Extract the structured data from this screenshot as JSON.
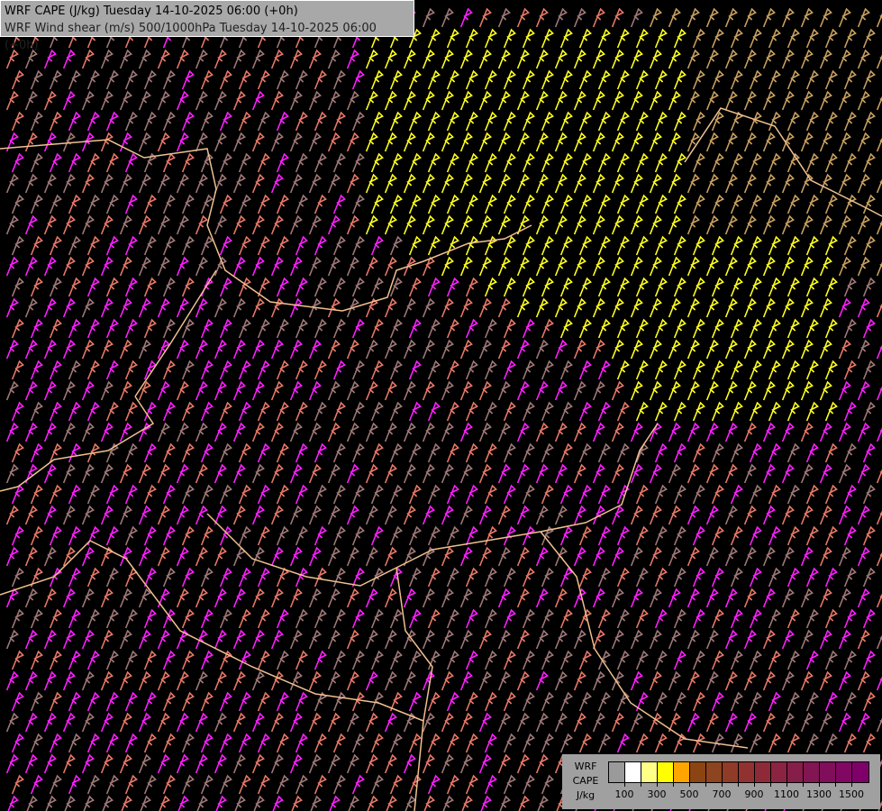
{
  "title": {
    "line1": "WRF CAPE (J/kg) Tuesday 14-10-2025 06:00 (+0h)",
    "line2": "WRF Wind shear (m/s) 500/1000hPa Tuesday 14-10-2025 06:00 (+0h)"
  },
  "legend": {
    "label_lines": [
      "WRF",
      "CAPE",
      "J/kg"
    ],
    "colors": [
      "#9a9a9a",
      "#ffffff",
      "#ffff88",
      "#ffff00",
      "#ffa500",
      "#8b4513",
      "#8d4420",
      "#903a28",
      "#923230",
      "#8e2a38",
      "#8a2442",
      "#861e4a",
      "#821652",
      "#800e5a",
      "#800862",
      "#80006a"
    ],
    "tick_labels": [
      "100",
      "300",
      "500",
      "700",
      "900",
      "1100",
      "1300",
      "1500"
    ]
  },
  "colors": {
    "background": "#000000",
    "border": "#f0c090",
    "river": "#3060c0",
    "barb_magenta": "#ff20ff",
    "barb_salmon": "#e87868",
    "barb_yellow": "#ffff20",
    "barb_tan": "#c8a060",
    "barb_gray": "#a07878"
  }
}
